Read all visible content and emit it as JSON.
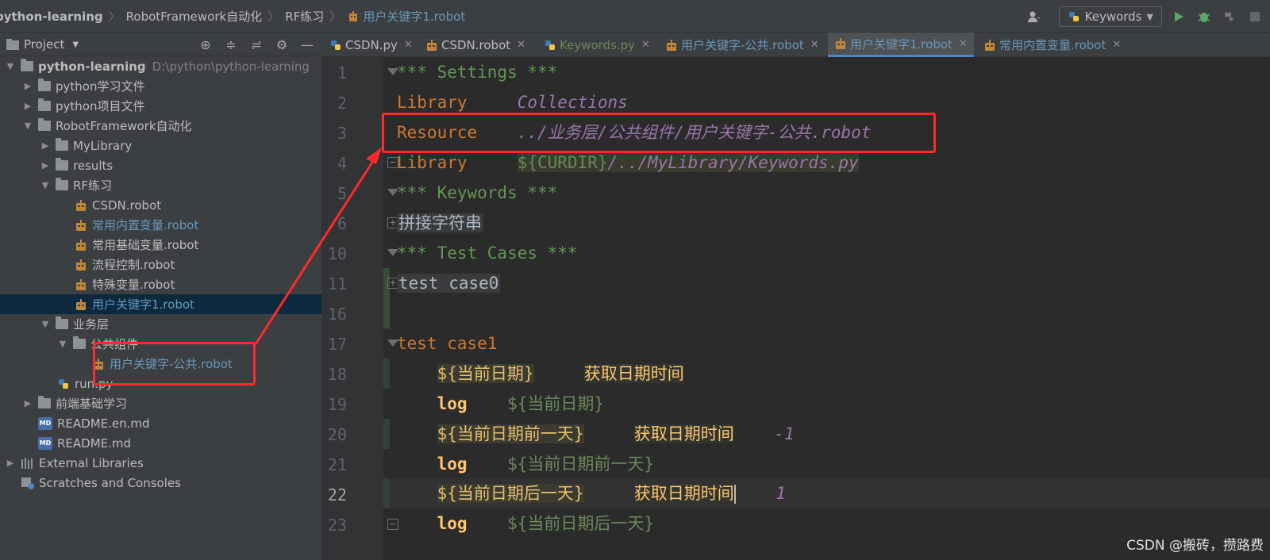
{
  "breadcrumb": {
    "items": [
      "python-learning",
      "RobotFramework自动化",
      "RF练习",
      "用户关键字1.robot"
    ]
  },
  "toolbar": {
    "run_config": "Keywords"
  },
  "project": {
    "title": "Project",
    "tree": [
      {
        "label": "python-learning",
        "path": "D:\\python\\python-learning"
      },
      {
        "label": "python学习文件"
      },
      {
        "label": "python项目文件"
      },
      {
        "label": "RobotFramework自动化"
      },
      {
        "label": "MyLibrary"
      },
      {
        "label": "results"
      },
      {
        "label": "RF练习"
      },
      {
        "label": "CSDN.robot"
      },
      {
        "label": "常用内置变量.robot"
      },
      {
        "label": "常用基础变量.robot"
      },
      {
        "label": "流程控制.robot"
      },
      {
        "label": "特殊变量.robot"
      },
      {
        "label": "用户关键字1.robot"
      },
      {
        "label": "业务层"
      },
      {
        "label": "公共组件"
      },
      {
        "label": "用户关键字-公共.robot"
      },
      {
        "label": "run.py"
      },
      {
        "label": "前端基础学习"
      },
      {
        "label": "README.en.md"
      },
      {
        "label": "README.md"
      },
      {
        "label": "External Libraries"
      },
      {
        "label": "Scratches and Consoles"
      }
    ]
  },
  "tabs": [
    {
      "label": "CSDN.py"
    },
    {
      "label": "CSDN.robot"
    },
    {
      "label": "Keywords.py"
    },
    {
      "label": "用户关键字-公共.robot"
    },
    {
      "label": "用户关键字1.robot"
    },
    {
      "label": "常用内置变量.robot"
    }
  ],
  "editor": {
    "line_numbers": [
      "1",
      "2",
      "3",
      "4",
      "5",
      "6",
      "10",
      "11",
      "16",
      "17",
      "18",
      "19",
      "20",
      "21",
      "22",
      "23"
    ],
    "l1": "*** Settings ***",
    "l2_kw": "Library",
    "l2_arg": "Collections",
    "l3_kw": "Resource",
    "l3_arg": "../业务层/公共组件/用户关键字-公共.robot",
    "l4_kw": "Library",
    "l4_var": "${CURDIR}",
    "l4_rest": "/../MyLibrary/Keywords.py",
    "l5": "*** Keywords ***",
    "l6": "拼接字符串",
    "l10": "*** Test Cases ***",
    "l11": "test case0",
    "l17": "test case1",
    "l18_var": "${当前日期}",
    "l18_call": "获取日期时间",
    "l19_log": "log",
    "l19_var": "${当前日期}",
    "l20_var": "${当前日期前一天}",
    "l20_call": "获取日期时间",
    "l20_num": "-1",
    "l21_log": "log",
    "l21_var": "${当前日期前一天}",
    "l22_var": "${当前日期后一天}",
    "l22_call": "获取日期时间",
    "l22_num": "1",
    "l23_log": "log",
    "l23_var": "${当前日期后一天}"
  },
  "watermark": "CSDN @搬砖，攒路费"
}
